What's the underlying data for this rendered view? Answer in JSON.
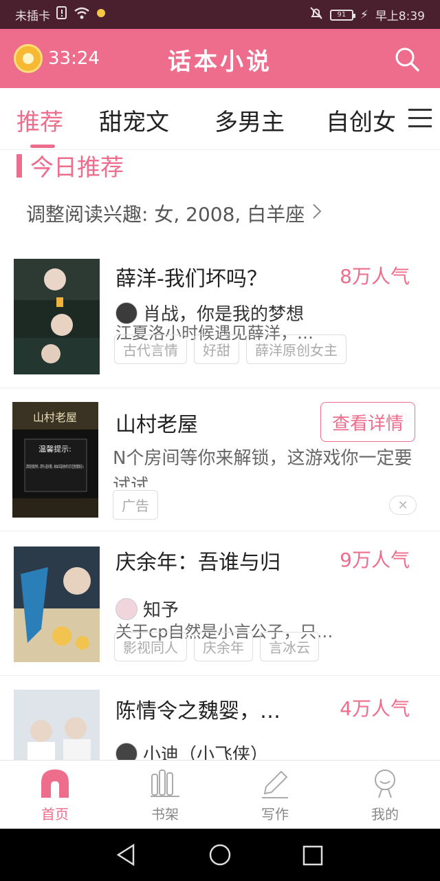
{
  "statusbar": {
    "carrier": "未插卡",
    "battery": "91",
    "time": "早上8:39"
  },
  "appbar": {
    "timer": "33:24",
    "title": "话本小说"
  },
  "tabs": [
    "推荐",
    "甜宠文",
    "多男主",
    "自创女"
  ],
  "section": {
    "title": "今日推荐",
    "interest": "调整阅读兴趣: 女, 2008, 白羊座"
  },
  "books": [
    {
      "title": "薛洋-我们坏吗？",
      "popularity": "8万人气",
      "author": "肖战，你是我的梦想",
      "desc": "江夏洛小时候遇见薛洋，…",
      "tags": [
        "古代言情",
        "好甜",
        "薛洋原创女主"
      ]
    },
    {
      "title": "庆余年：吾谁与归",
      "popularity": "9万人气",
      "author": "知予",
      "desc": "关于cp自然是小言公子，只…",
      "tags": [
        "影视同人",
        "庆余年",
        "言冰云"
      ]
    },
    {
      "title": "陈情令之魏婴，…",
      "popularity": "4万人气",
      "author": "小迪（小飞侠）",
      "desc": "",
      "tags": []
    }
  ],
  "ad": {
    "title": "山村老屋",
    "button": "查看详情",
    "desc": "N个房间等你来解锁，这游戏你一定要试试",
    "tag": "广告",
    "cover_title": "山村老屋",
    "cover_warning_title": "温馨提示:",
    "cover_warning_text": "游戏轻微恐怖，请有心脏问题、高血压或身体状况欠佳者谨慎进入"
  },
  "bottom_nav": [
    "首页",
    "书架",
    "写作",
    "我的"
  ],
  "colors": {
    "accent": "#ef6d8c",
    "statusbar": "#4a1f2e"
  }
}
